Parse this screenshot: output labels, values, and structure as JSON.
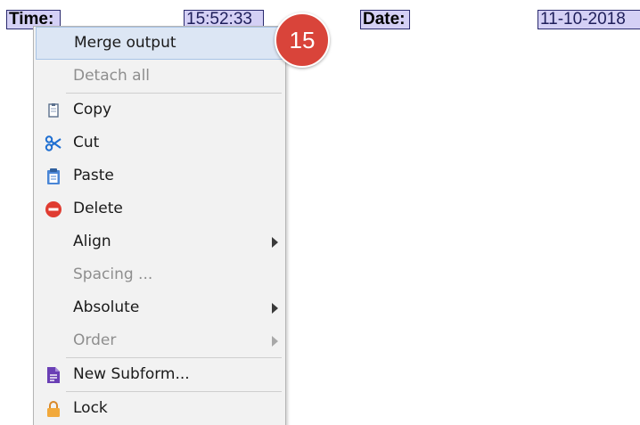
{
  "form": {
    "time_label": "Time:",
    "time_value": "15:52:33",
    "date_label": "Date:",
    "date_value": "11-10-2018"
  },
  "menu": {
    "items": [
      {
        "label": "Merge output"
      },
      {
        "label": "Detach all"
      },
      {
        "label": "Copy",
        "icon": "copy-icon"
      },
      {
        "label": "Cut",
        "icon": "scissors-icon"
      },
      {
        "label": "Paste",
        "icon": "paste-icon"
      },
      {
        "label": "Delete",
        "icon": "delete-icon"
      },
      {
        "label": "Align"
      },
      {
        "label": "Spacing ..."
      },
      {
        "label": "Absolute"
      },
      {
        "label": "Order"
      },
      {
        "label": "New Subform...",
        "icon": "subform-icon"
      },
      {
        "label": "Lock",
        "icon": "lock-icon"
      }
    ]
  },
  "badge": {
    "number": "15"
  },
  "colors": {
    "field_fill": "#d4d0f5",
    "menu_bg": "#f2f2f2",
    "highlight": "#dce6f4",
    "badge": "#d9443a"
  }
}
